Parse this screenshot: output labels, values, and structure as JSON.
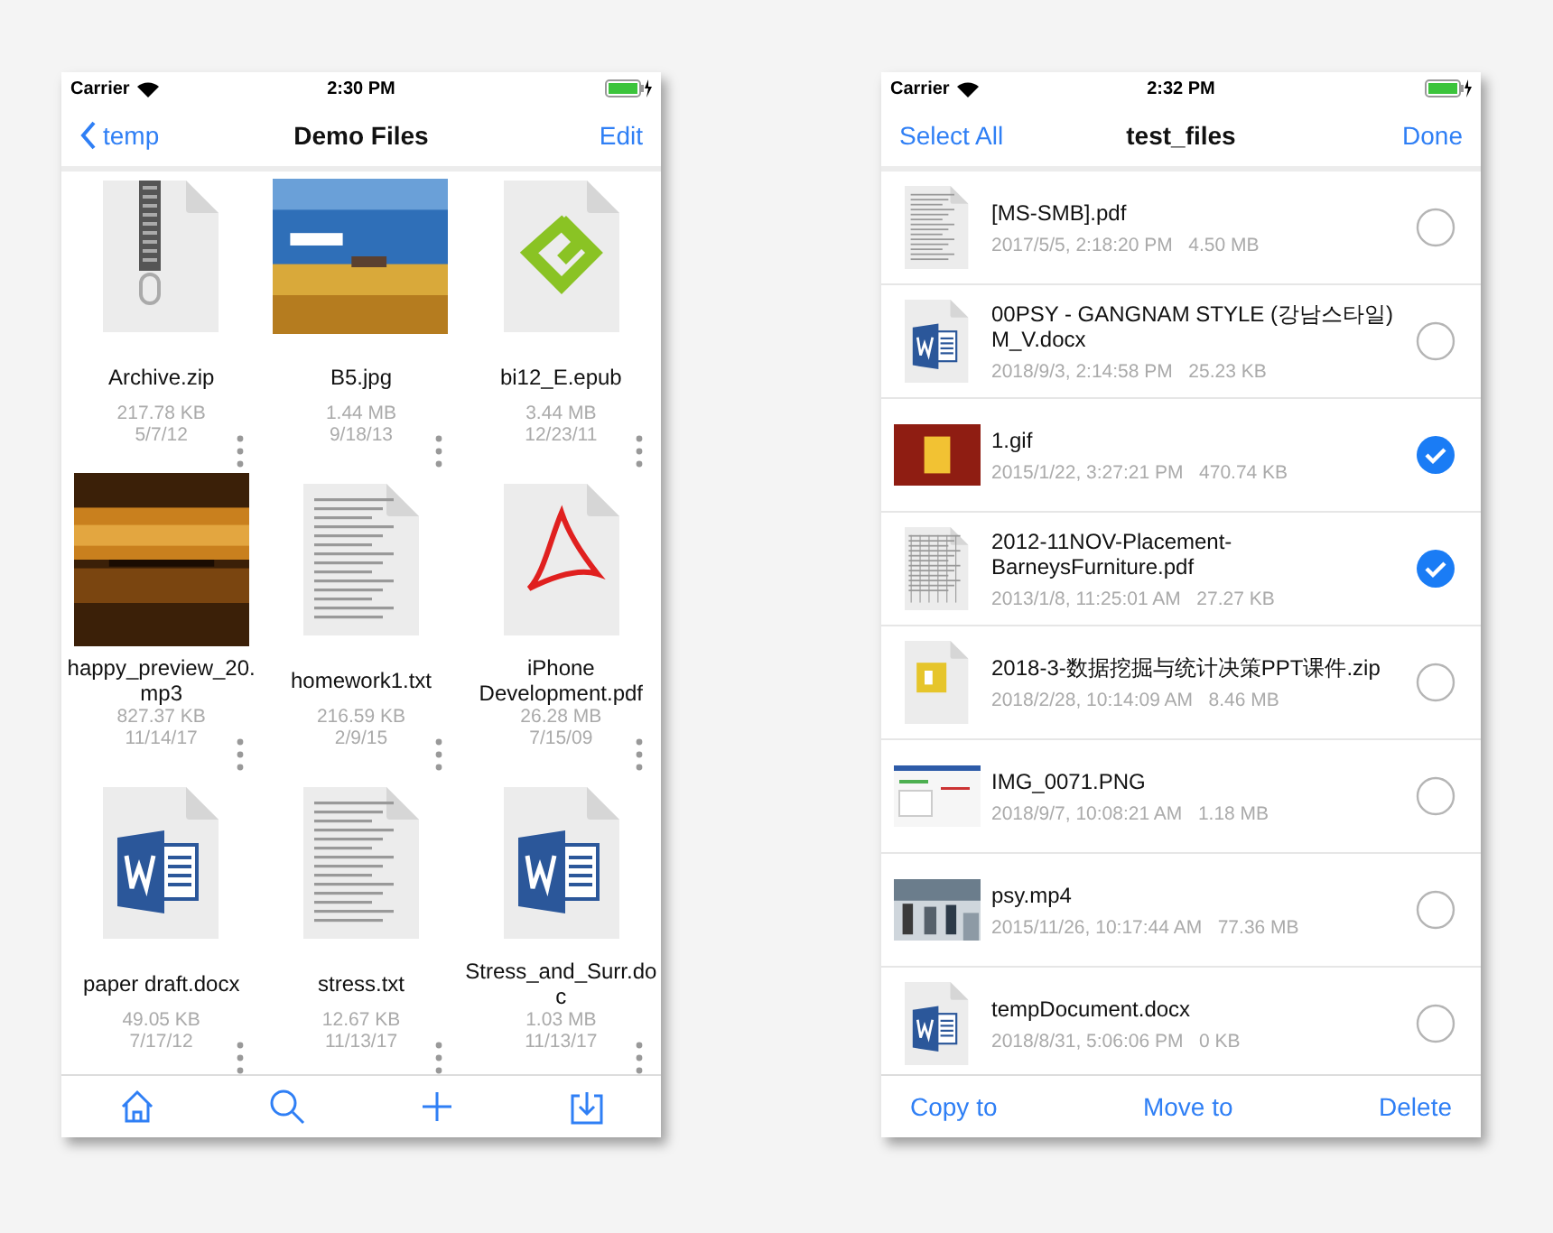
{
  "left_phone": {
    "status_bar": {
      "carrier": "Carrier",
      "time": "2:30 PM"
    },
    "nav": {
      "back": "temp",
      "title": "Demo Files",
      "action": "Edit"
    },
    "files": [
      {
        "kind": "zip",
        "name": "Archive.zip",
        "size": "217.78 KB",
        "date": "5/7/12"
      },
      {
        "kind": "picture",
        "name": "B5.jpg",
        "size": "1.44 MB",
        "date": "9/18/13"
      },
      {
        "kind": "epub",
        "name": "bi12_E.epub",
        "size": "3.44 MB",
        "date": "12/23/11"
      },
      {
        "kind": "picture",
        "name": "happy_preview_20.mp3",
        "size": "827.37 KB",
        "date": "11/14/17"
      },
      {
        "kind": "text",
        "name": "homework1.txt",
        "size": "216.59 KB",
        "date": "2/9/15"
      },
      {
        "kind": "pdf",
        "name": "iPhone Development.pdf",
        "size": "26.28 MB",
        "date": "7/15/09"
      },
      {
        "kind": "word",
        "name": "paper draft.docx",
        "size": "49.05 KB",
        "date": "7/17/12"
      },
      {
        "kind": "text",
        "name": "stress.txt",
        "size": "12.67 KB",
        "date": "11/13/17"
      },
      {
        "kind": "word",
        "name": "Stress_and_Surr.doc",
        "size": "1.03 MB",
        "date": "11/13/17"
      }
    ],
    "toolbar": [
      {
        "kind": "home"
      },
      {
        "kind": "search"
      },
      {
        "kind": "add"
      },
      {
        "kind": "import"
      }
    ]
  },
  "right_phone": {
    "status_bar": {
      "carrier": "Carrier",
      "time": "2:32 PM"
    },
    "nav": {
      "left": "Select All",
      "title": "test_files",
      "right": "Done"
    },
    "files": [
      {
        "kind": "document",
        "name": "[MS-SMB].pdf",
        "date": "2017/5/5, 2:18:20 PM",
        "size": "4.50 MB",
        "selected": false
      },
      {
        "kind": "word",
        "name": "00PSY - GANGNAM STYLE (강남스타일) M_V.docx",
        "date": "2018/9/3, 2:14:58 PM",
        "size": "25.23 KB",
        "selected": false
      },
      {
        "kind": "picture",
        "name": "1.gif",
        "date": "2015/1/22, 3:27:21 PM",
        "size": "470.74 KB",
        "selected": true
      },
      {
        "kind": "spreadsheet",
        "name": "2012-11NOV-Placement-BarneysFurniture.pdf",
        "date": "2013/1/8, 11:25:01 AM",
        "size": "27.27 KB",
        "selected": true
      },
      {
        "kind": "zip",
        "name": "2018-3-数据挖掘与统计决策PPT课件.zip",
        "date": "2018/2/28, 10:14:09 AM",
        "size": "8.46 MB",
        "selected": false
      },
      {
        "kind": "screenshot",
        "name": "IMG_0071.PNG",
        "date": "2018/9/7, 10:08:21 AM",
        "size": "1.18 MB",
        "selected": false
      },
      {
        "kind": "picture",
        "name": "psy.mp4",
        "date": "2015/11/26, 10:17:44 AM",
        "size": "77.36 MB",
        "selected": false
      },
      {
        "kind": "word",
        "name": "tempDocument.docx",
        "date": "2018/8/31, 5:06:06 PM",
        "size": "0 KB",
        "selected": false
      }
    ],
    "actions": [
      "Copy to",
      "Move to",
      "Delete"
    ]
  }
}
